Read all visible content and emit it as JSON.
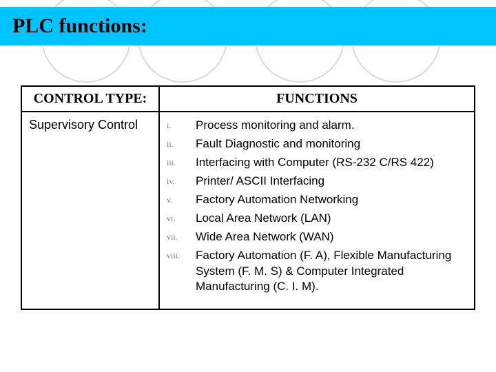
{
  "title": "PLC functions:",
  "headers": {
    "control_type": "CONTROL TYPE:",
    "functions": "FUNCTIONS"
  },
  "rows": [
    {
      "type": "Supervisory Control",
      "functions": [
        {
          "num": "i.",
          "text": "Process monitoring and alarm."
        },
        {
          "num": "ii.",
          "text": "Fault Diagnostic and monitoring"
        },
        {
          "num": "iii.",
          "text": "Interfacing with Computer (RS-232 C/RS 422)"
        },
        {
          "num": "iv.",
          "text": "Printer/ ASCII Interfacing"
        },
        {
          "num": "v.",
          "text": "Factory Automation Networking"
        },
        {
          "num": "vi.",
          "text": "Local Area Network (LAN)"
        },
        {
          "num": "vii.",
          "text": "Wide Area Network (WAN)"
        },
        {
          "num": "viii.",
          "text": "Factory Automation (F. A), Flexible Manufacturing System (F. M. S) & Computer Integrated Manufacturing (C. I. M)."
        }
      ]
    }
  ]
}
